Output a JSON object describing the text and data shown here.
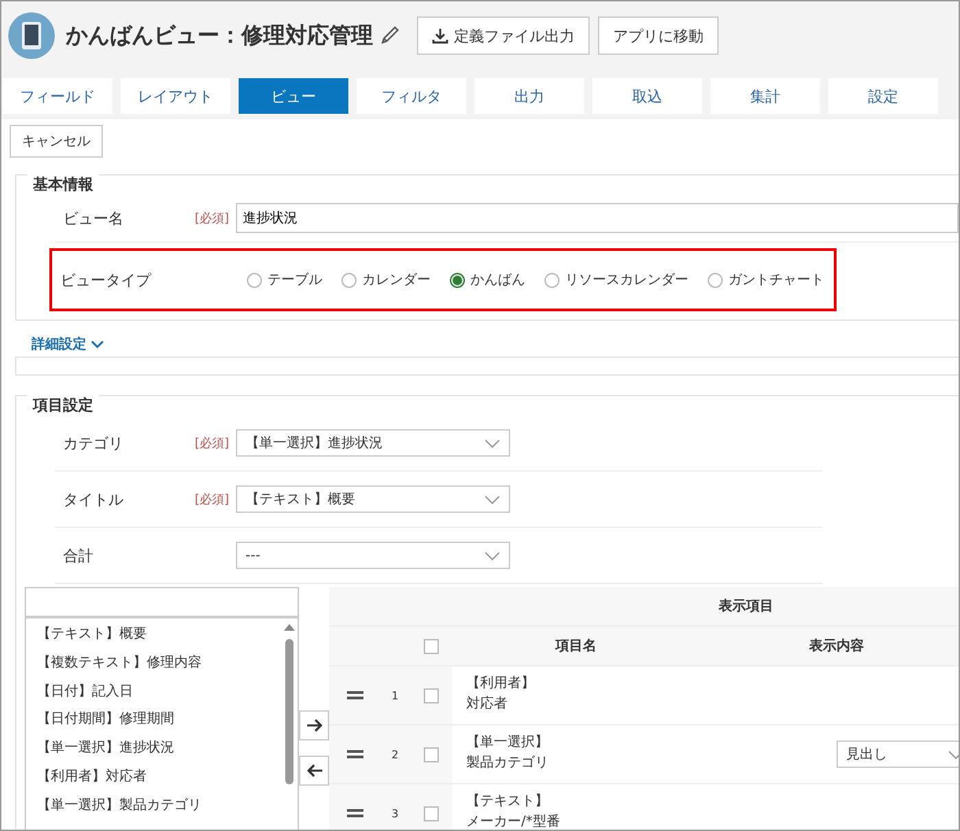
{
  "header": {
    "title": "かんばんビュー：修理対応管理",
    "buttons": [
      {
        "label": "定義ファイル出力",
        "kind": "download"
      },
      {
        "label": "アプリに移動",
        "kind": "plain"
      }
    ]
  },
  "tabs": [
    {
      "label": "フィールド",
      "selected": false
    },
    {
      "label": "レイアウト",
      "selected": false
    },
    {
      "label": "ビュー",
      "selected": true
    },
    {
      "label": "フィルタ",
      "selected": false
    },
    {
      "label": "出力",
      "selected": false
    },
    {
      "label": "取込",
      "selected": false
    },
    {
      "label": "集計",
      "selected": false
    },
    {
      "label": "設定",
      "selected": false
    }
  ],
  "cancel_button": "キャンセル",
  "basic_info": {
    "heading": "基本情報",
    "view_name": {
      "label": "ビュー名",
      "required": "[必須]",
      "value": "進捗状況"
    },
    "view_type": {
      "label": "ビュータイプ",
      "highlighted": true,
      "options": [
        {
          "label": "テーブル",
          "selected": false
        },
        {
          "label": "カレンダー",
          "selected": false
        },
        {
          "label": "かんばん",
          "selected": true
        },
        {
          "label": "リソースカレンダー",
          "selected": false
        },
        {
          "label": "ガントチャート",
          "selected": false
        }
      ]
    }
  },
  "advanced_link": {
    "label": "詳細設定",
    "expanded": false
  },
  "item_settings": {
    "heading": "項目設定",
    "fields": [
      {
        "label": "カテゴリ",
        "required": "[必須]",
        "value": "【単一選択】進捗状況"
      },
      {
        "label": "タイトル",
        "required": "[必須]",
        "value": "【テキスト】概要"
      },
      {
        "label": "合計",
        "value": "---"
      }
    ]
  },
  "available_fields": {
    "items": [
      "【テキスト】概要",
      "【複数テキスト】修理内容",
      "【日付】記入日",
      "【日付期間】修理期間",
      "【単一選択】進捗状況",
      "【利用者】対応者",
      "【単一選択】製品カテゴリ"
    ]
  },
  "move_buttons": [
    {
      "kind": "right"
    },
    {
      "kind": "left"
    }
  ],
  "display_table": {
    "group_header": "表示項目",
    "all_checked": false,
    "columns": [
      "項目名",
      "表示内容"
    ],
    "rows": [
      {
        "number": "1",
        "checked": false,
        "type": "【利用者】",
        "name": "対応者"
      },
      {
        "number": "2",
        "checked": false,
        "type": "【単一選択】",
        "name": "製品カテゴリ",
        "display": "見出し"
      },
      {
        "number": "3",
        "checked": false,
        "type": "【テキスト】",
        "name": "メーカー/*型番"
      }
    ]
  }
}
